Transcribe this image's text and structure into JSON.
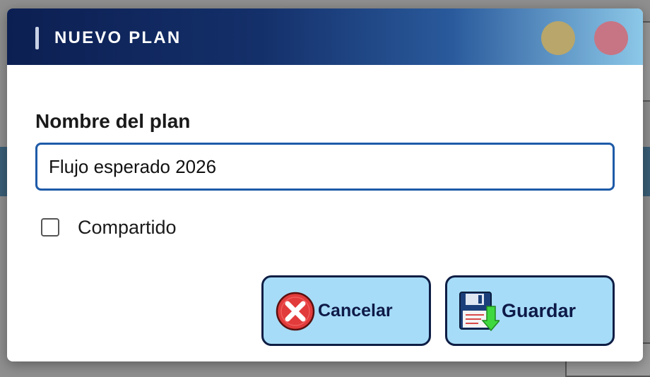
{
  "dialog": {
    "title": "NUEVO PLAN",
    "field_label": "Nombre del plan",
    "input_value": "Flujo esperado 2026",
    "checkbox_label": "Compartido",
    "checkbox_checked": false,
    "cancel_label": "Cancelar",
    "save_label": "Guardar",
    "cancel_icon": "cancel-x-icon",
    "save_icon": "floppy-disk-save-icon"
  },
  "colors": {
    "title_gradient_start": "#0c1f52",
    "title_gradient_end": "#8cc8e8",
    "input_border": "#1e5aa8",
    "button_fill": "#a6dcf7",
    "button_border": "#0f1e45",
    "button_text": "#0e1a48",
    "minimize_button": "#b8a66a",
    "close_button": "#c77584"
  }
}
